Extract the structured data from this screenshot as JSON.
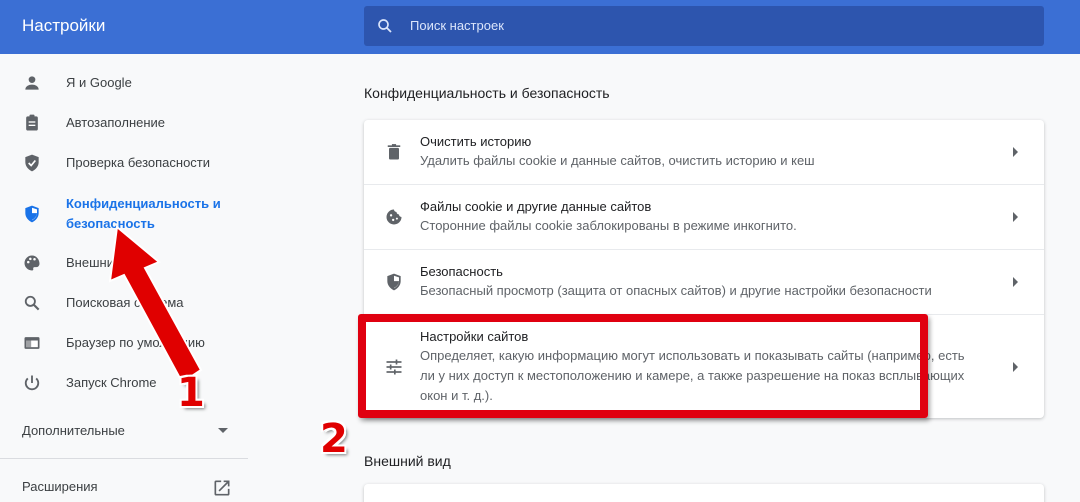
{
  "header": {
    "title": "Настройки",
    "search_placeholder": "Поиск настроек",
    "color": "#3b6fd4"
  },
  "sidebar": {
    "items": [
      {
        "label": "Я и Google",
        "icon": "person-icon"
      },
      {
        "label": "Автозаполнение",
        "icon": "clipboard-icon"
      },
      {
        "label": "Проверка безопасности",
        "icon": "shield-check-icon"
      },
      {
        "label": "Конфиденциальность и безопасность",
        "icon": "privacy-shield-icon",
        "active": true
      },
      {
        "label": "Внешний вид",
        "icon": "palette-icon"
      },
      {
        "label": "Поисковая система",
        "icon": "search-icon"
      },
      {
        "label": "Браузер по умолчанию",
        "icon": "browser-icon"
      },
      {
        "label": "Запуск Chrome",
        "icon": "power-icon"
      }
    ],
    "advanced_label": "Дополнительные",
    "extensions_label": "Расширения"
  },
  "main": {
    "privacy_section_title": "Конфиденциальность и безопасность",
    "rows": [
      {
        "title": "Очистить историю",
        "desc": "Удалить файлы cookie и данные сайтов, очистить историю и кеш",
        "icon": "trash-icon"
      },
      {
        "title": "Файлы cookie и другие данные сайтов",
        "desc": "Сторонние файлы cookie заблокированы в режиме инкогнито.",
        "icon": "cookie-icon"
      },
      {
        "title": "Безопасность",
        "desc": "Безопасный просмотр (защита от опасных сайтов) и другие настройки безопасности",
        "icon": "security-shield-icon"
      },
      {
        "title": "Настройки сайтов",
        "desc": "Определяет, какую информацию могут использовать и показывать сайты (например, есть ли у них доступ к местоположению и камере, а также разрешение на показ всплывающих окон и т. д.).",
        "icon": "tune-icon"
      }
    ],
    "appearance_section_title": "Внешний вид"
  },
  "annotations": {
    "step1": "1",
    "step2": "2",
    "color": "#e00000"
  }
}
